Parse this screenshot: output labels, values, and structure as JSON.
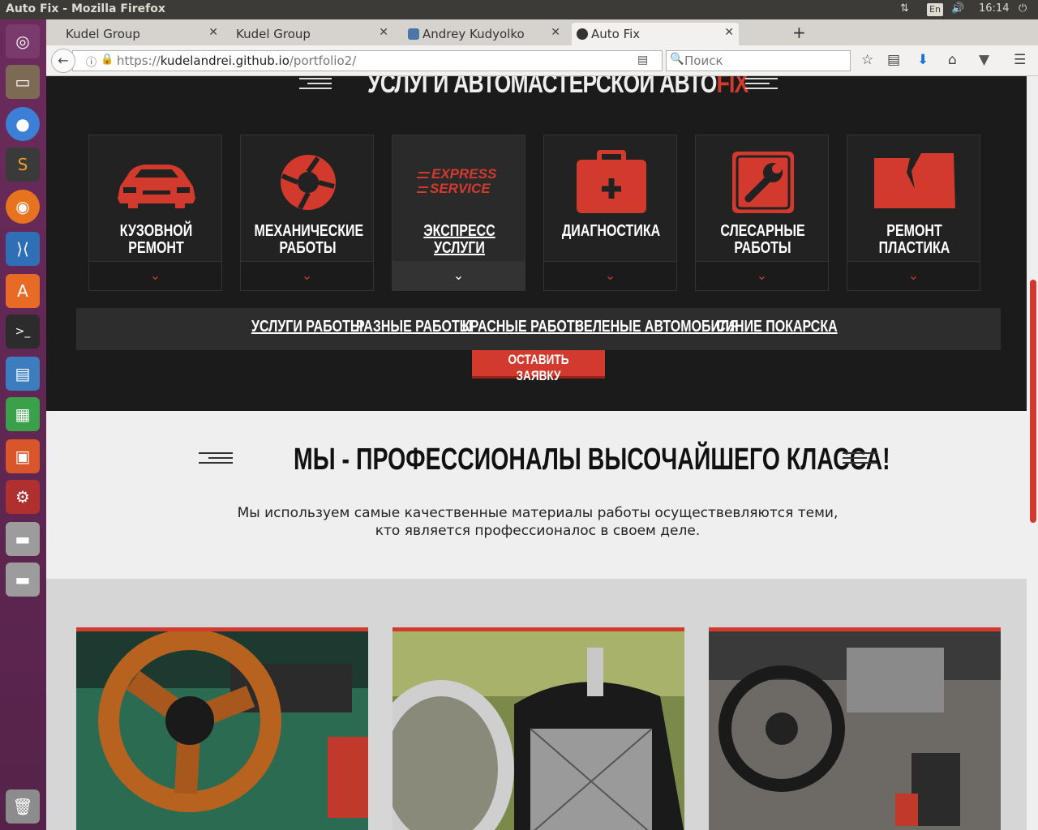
{
  "system": {
    "window_title": "Auto Fix - Mozilla Firefox",
    "lang": "En",
    "clock": "16:14"
  },
  "browser": {
    "tabs": [
      {
        "label": "Kudel Group"
      },
      {
        "label": "Kudel Group"
      },
      {
        "label": "Andrey Kudyolko"
      },
      {
        "label": "Auto Fix"
      }
    ],
    "url_prefix": "https://",
    "url_host": "kudelandrei.github.io",
    "url_path": "/portfolio2/",
    "search_placeholder": "Поиск"
  },
  "services": {
    "title_main": "УСЛУГИ АВТОМАСТЕРСКОЙ АВТО",
    "title_accent": "FIX",
    "cards": [
      {
        "label": "КУЗОВНОЙ РЕМОНТ",
        "icon": "car-icon"
      },
      {
        "label": "МЕХАНИЧЕСКИЕ РАБОТЫ",
        "icon": "gear-icon"
      },
      {
        "label": "ЭКСПРЕСС УСЛУГИ",
        "icon": "express-service-icon",
        "icon_text1": "EXPRESS",
        "icon_text2": "SERVICE"
      },
      {
        "label": "ДИАГНОСТИКА",
        "icon": "first-aid-kit-icon"
      },
      {
        "label": "СЛЕСАРНЫЕ РАБОТЫ",
        "icon": "wrench-icon"
      },
      {
        "label": "РЕМОНТ ПЛАСТИКА",
        "icon": "broken-panel-icon"
      }
    ],
    "subnav": [
      "УСЛУГИ РАБОТЫ",
      "РАЗНЫЕ РАБОТЫ",
      "КРАСНЫЕ РАБОТЫ",
      "ЗЕЛЕНЫЕ АВТОМОБИЛЯ",
      "СИНИЕ ПОКАРСКА"
    ],
    "order_button": "ОСТАВИТЬ ЗАЯВКУ"
  },
  "pro": {
    "title": "МЫ - ПРОФЕССИОНАЛЫ ВЫСОЧАЙШЕГО КЛАССА!",
    "text": "Мы используем самые качественные материалы работы осуществевляются теми, кто является профессионалос в своем деле."
  },
  "colors": {
    "accent": "#d23a2e",
    "dark_bg": "#1b1b1b",
    "launcher": "#5e2750"
  }
}
